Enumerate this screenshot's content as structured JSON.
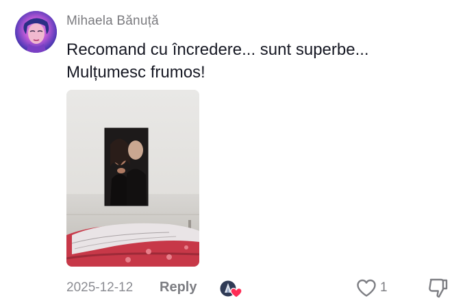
{
  "comment": {
    "username": "Mihaela Bănuță",
    "text_line1": "Recomand cu încredere... sunt superbe...",
    "text_line2": "Mulțumesc frumos!"
  },
  "footer": {
    "date": "2025-12-12",
    "reply_label": "Reply",
    "like_count": "1"
  },
  "icons": {
    "like": "heart-outline-icon",
    "dislike": "thumbs-down-icon",
    "creator_liked": "creator-liked-badge-icon"
  },
  "colors": {
    "text_primary": "#161823",
    "text_secondary": "#7c7d82",
    "liked_heart": "#fe2c55"
  }
}
